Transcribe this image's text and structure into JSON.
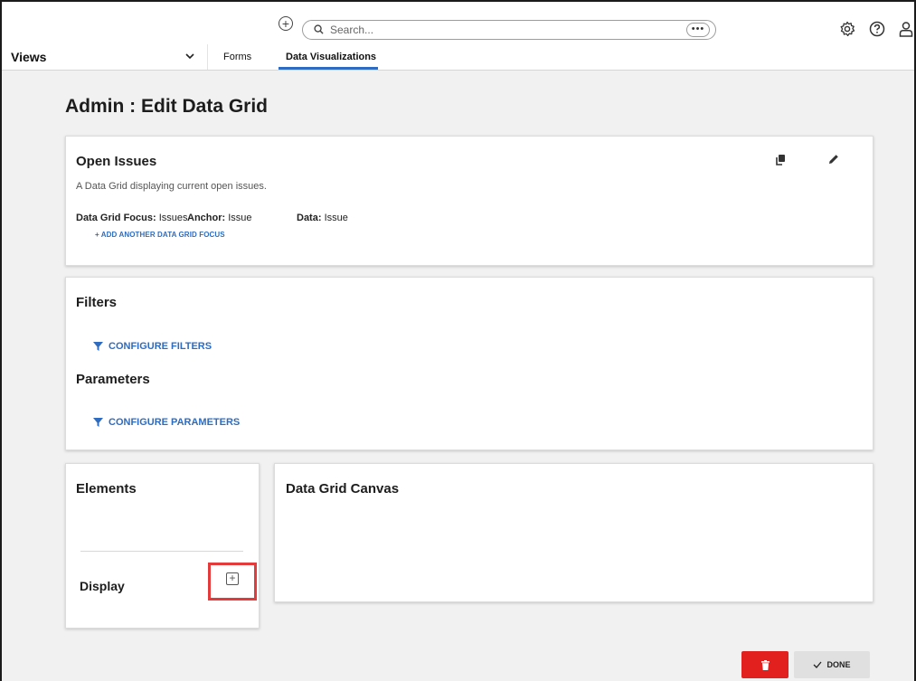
{
  "topbar": {
    "search_placeholder": "Search...",
    "more_label": "•••",
    "add_symbol": "+"
  },
  "nav": {
    "views_label": "Views",
    "tabs": [
      {
        "label": "Forms",
        "active": false
      },
      {
        "label": "Data Visualizations",
        "active": true
      }
    ]
  },
  "page": {
    "title": "Admin : Edit Data Grid"
  },
  "open_issues": {
    "title": "Open Issues",
    "description": "A Data Grid displaying current open issues.",
    "focus_label": "Data Grid Focus:",
    "focus_value": "Issues",
    "anchor_label": "Anchor:",
    "anchor_value": "Issue",
    "data_label": "Data:",
    "data_value": "Issue",
    "add_focus": "+ ADD ANOTHER DATA GRID FOCUS"
  },
  "filters": {
    "title": "Filters",
    "configure_filters": "CONFIGURE FILTERS",
    "parameters_title": "Parameters",
    "configure_parameters": "CONFIGURE PARAMETERS"
  },
  "elements": {
    "title": "Elements",
    "display_label": "Display",
    "plus_symbol": "+"
  },
  "canvas": {
    "title": "Data Grid Canvas"
  },
  "actions": {
    "done_label": "DONE"
  },
  "colors": {
    "accent": "#2d6cc0",
    "delete": "#e2201e",
    "highlight": "#e33b3b"
  }
}
